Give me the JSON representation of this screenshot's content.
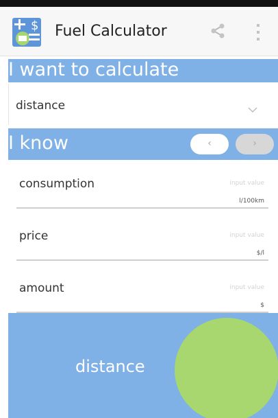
{
  "app": {
    "title": "Fuel Calculator",
    "icons": {
      "app": "fuel-calculator-app-icon",
      "share": "share-icon",
      "menu": "overflow-menu-icon"
    }
  },
  "calculate": {
    "header": "I want to calculate",
    "selected": "distance"
  },
  "know": {
    "header": "I know",
    "prev_label": "‹",
    "next_label": "›",
    "fields": [
      {
        "label": "consumption",
        "placeholder": "input value",
        "unit": "l/100km"
      },
      {
        "label": "price",
        "placeholder": "input value",
        "unit": "$/l"
      },
      {
        "label": "amount",
        "placeholder": "input value",
        "unit": "$"
      }
    ]
  },
  "result": {
    "label": "distance"
  },
  "colors": {
    "accent": "#7fb0e6",
    "button": "#a7d76e",
    "toggle_off": "#d7d7d7"
  }
}
